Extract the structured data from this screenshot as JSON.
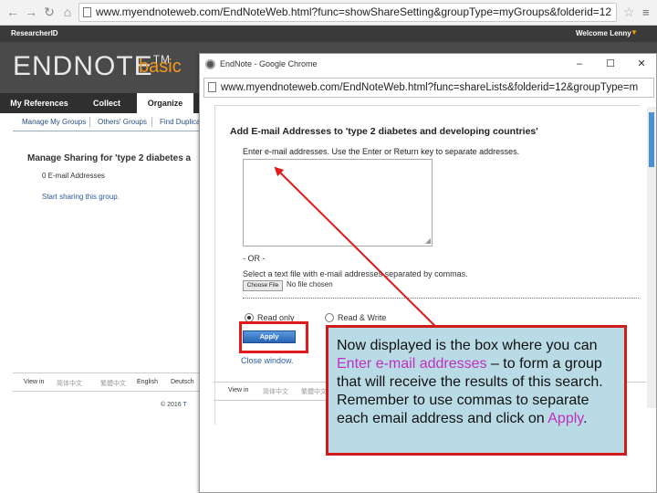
{
  "background_browser": {
    "url": "www.myendnoteweb.com/EndNoteWeb.html?func=showShareSetting&groupType=myGroups&folderid=12",
    "nav": {
      "back_icon": "arrow-left-icon",
      "forward_icon": "arrow-right-icon",
      "reload_icon": "reload-icon"
    }
  },
  "endnote": {
    "researcher_id": "ResearcherID",
    "welcome": "Welcome Lenny",
    "logo": "ENDNOTE",
    "logo_tm": "TM",
    "logo_basic": "basic",
    "tabs": [
      "My References",
      "Collect",
      "Organize"
    ],
    "active_tab": "Organize",
    "subtabs": [
      "Manage My Groups",
      "Others' Groups",
      "Find Duplica"
    ],
    "manage_title": "Manage Sharing for 'type 2 diabetes a",
    "email_count": "0 E-mail Addresses",
    "start_sharing": "Start sharing this group.",
    "footer_langs": [
      "View in",
      "简体中文",
      "繁體中文",
      "English",
      "Deutsch"
    ],
    "copyright": "© 2016",
    "copyright_link": "T"
  },
  "popup": {
    "window_title": "EndNote - Google Chrome",
    "controls": {
      "minimize": "–",
      "maximize": "☐",
      "close": "✕"
    },
    "url": "www.myendnoteweb.com/EndNoteWeb.html?func=shareLists&folderid=12&groupType=m",
    "heading": "Add E-mail Addresses to 'type 2 diabetes and developing countries'",
    "instruction": "Enter e-mail addresses. Use the Enter or Return key to separate addresses.",
    "or_divider": "- OR -",
    "select_file_label": "Select a text file with e-mail addresses separated by commas.",
    "choose_file_button": "Choose File",
    "no_file_text": "No file chosen",
    "permission_options": [
      {
        "label": "Read only",
        "checked": true
      },
      {
        "label": "Read & Write",
        "checked": false
      }
    ],
    "apply_button": "Apply",
    "close_window": "Close window.",
    "footer_langs": [
      "View in",
      "简体中文",
      "繁體中文"
    ]
  },
  "callout": {
    "text_before": "Now displayed is the box where you can ",
    "highlight_1": "Enter e-mail addresses",
    "text_middle": " – to form a group that will receive the results of this search.  Remember to use commas to separate each email address and click on ",
    "highlight_2": "Apply",
    "text_after": ".",
    "highlight_color": "#c02fbf",
    "border_color": "#d11b1b",
    "background_color": "#b9dbe6"
  },
  "colors": {
    "endnote_orange": "#f29a1f",
    "link_blue": "#2b5aa0",
    "annotation_red": "#e01b1b"
  }
}
